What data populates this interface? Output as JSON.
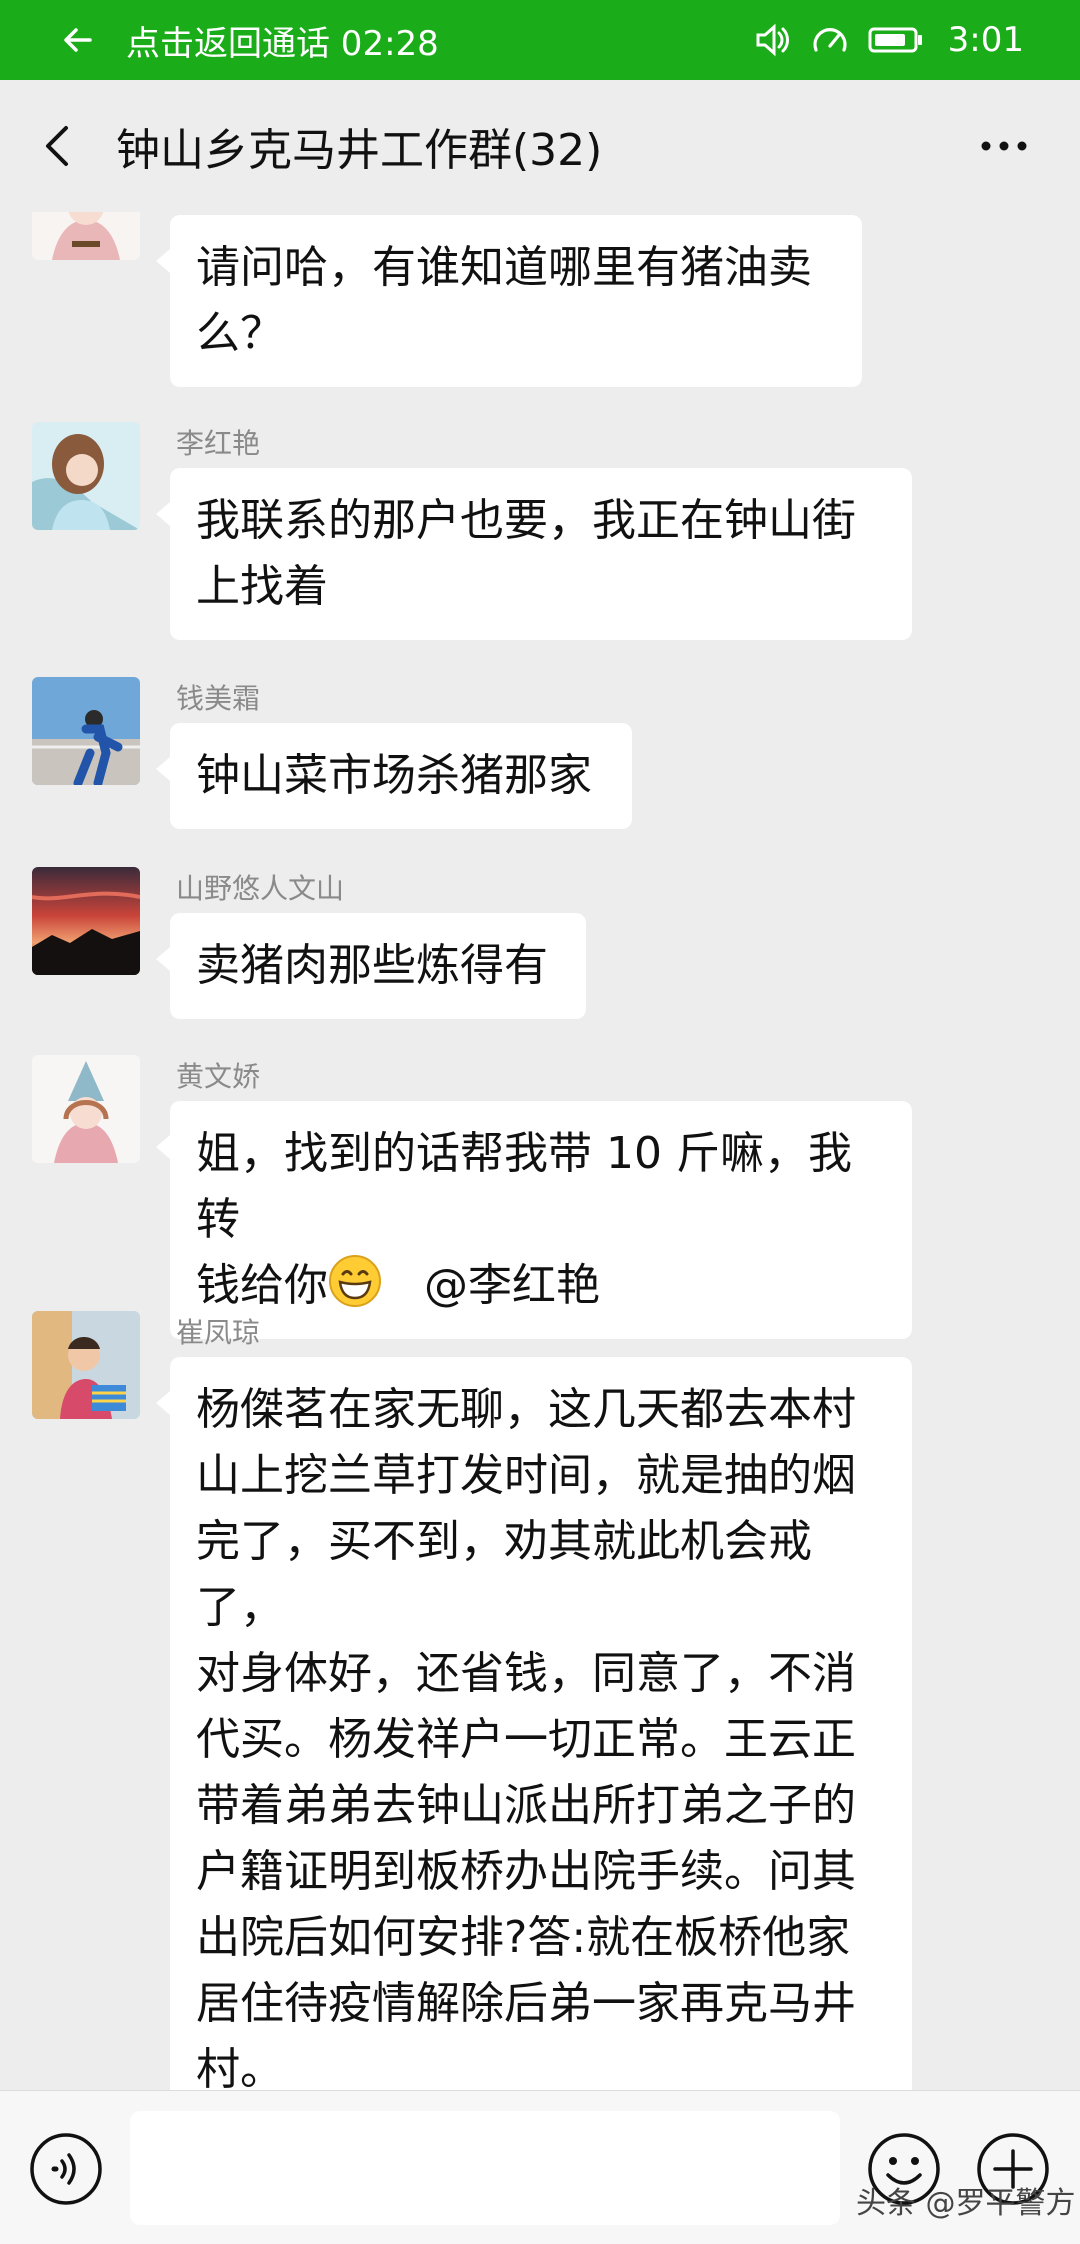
{
  "status_bar": {
    "call_return_text": "点击返回通话 02:28",
    "time": "3:01"
  },
  "header": {
    "title": "钟山乡克马井工作群(32)"
  },
  "messages": [
    {
      "sender": "",
      "avatar": "avatar-girl-illustration",
      "lines": [
        "请问哈，有谁知道哪里有猪油卖",
        "么？"
      ]
    },
    {
      "sender": "李红艳",
      "avatar": "avatar-woman-photo",
      "lines": [
        "我联系的那户也要，我正在钟山街",
        "上找着"
      ]
    },
    {
      "sender": "钱美霜",
      "avatar": "avatar-runner-photo",
      "lines": [
        "钟山菜市场杀猪那家"
      ]
    },
    {
      "sender": "山野悠人文山",
      "avatar": "avatar-sunset-photo",
      "lines": [
        "卖猪肉那些炼得有"
      ]
    },
    {
      "sender": "黄文娇",
      "avatar": "avatar-girl-illustration",
      "lines": [
        "姐，找到的话帮我带 10 斤嘛，我转",
        "钱给你"
      ],
      "mention": "@李红艳"
    },
    {
      "sender": "崔凤琼",
      "avatar": "avatar-child-photo",
      "lines": [
        "杨傑茗在家无聊，这几天都去本村",
        "山上挖兰草打发时间，就是抽的烟",
        "完了，买不到，劝其就此机会戒了，",
        "对身体好，还省钱，同意了，不消",
        "代买。杨发祥户一切正常。王云正",
        "带着弟弟去钟山派出所打弟之子的",
        "户籍证明到板桥办出院手续。问其",
        "出院后如何安排?答:就在板桥他家",
        "居住待疫情解除后弟一家再克马井",
        "村。"
      ]
    }
  ],
  "input_bar": {
    "placeholder": ""
  },
  "watermark": "头条 @罗平警方",
  "colors": {
    "status_green": "#1aad19",
    "chat_bg": "#ededed",
    "bubble": "#ffffff"
  }
}
